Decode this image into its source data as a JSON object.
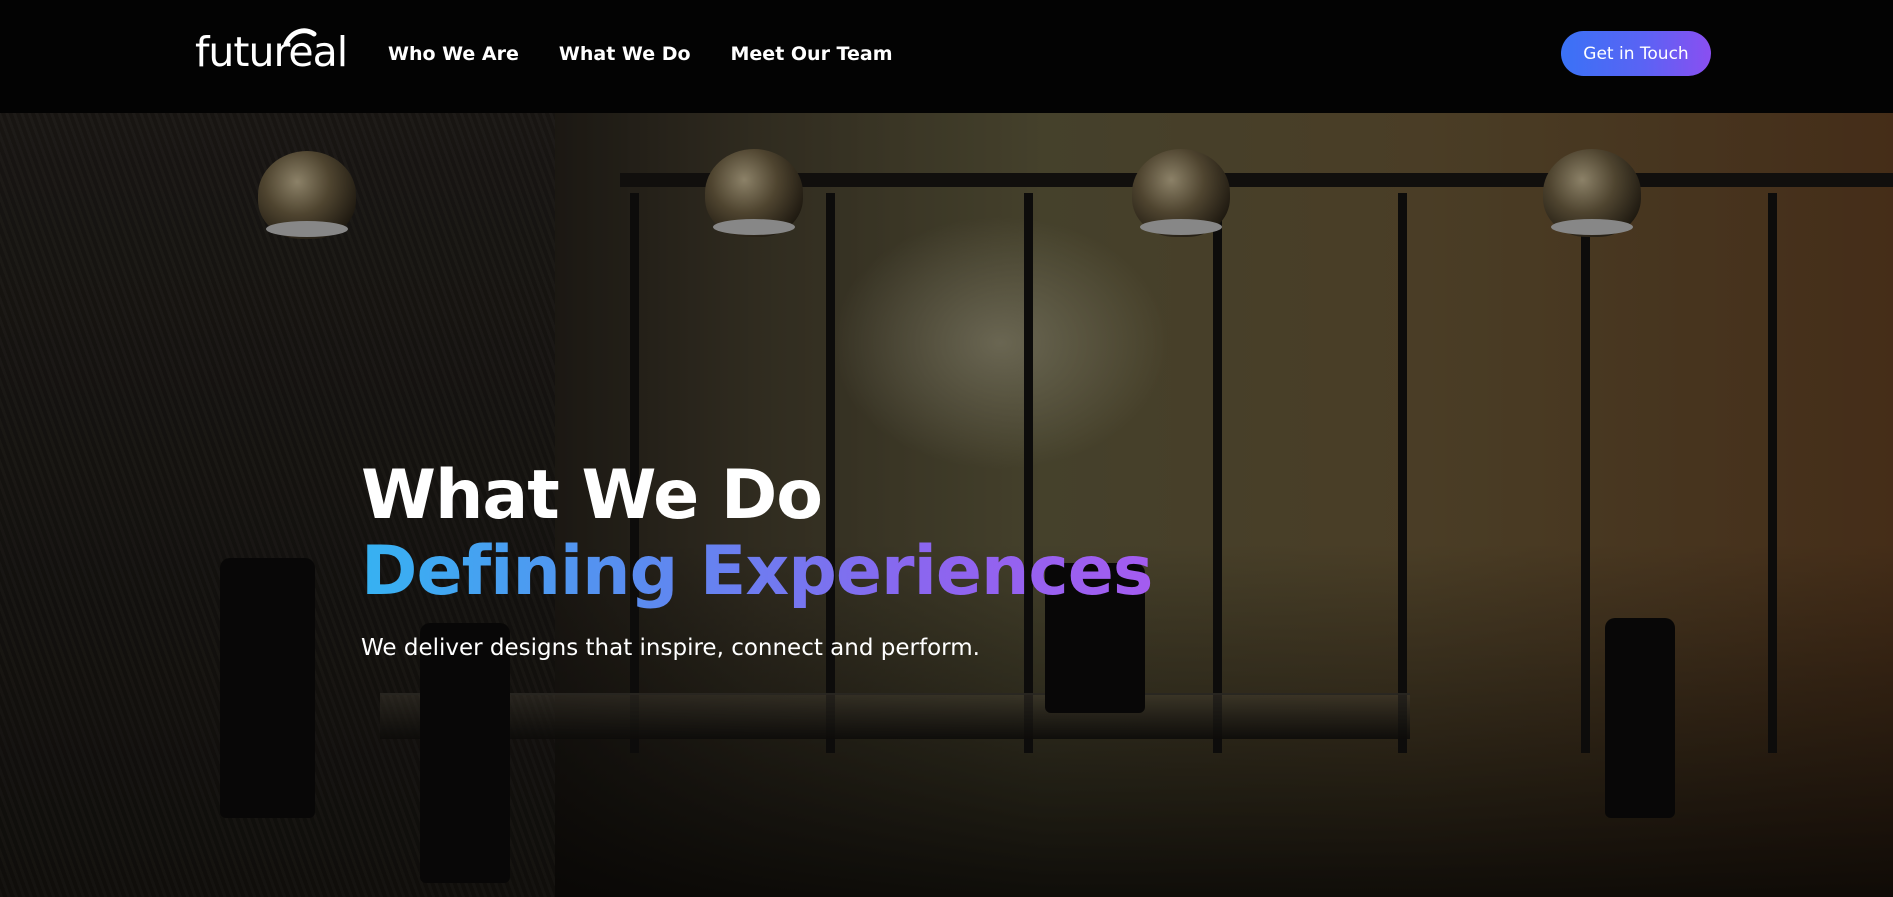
{
  "header": {
    "logo_text": "futureal",
    "nav": [
      {
        "label": "Who We Are"
      },
      {
        "label": "What We Do"
      },
      {
        "label": "Meet Our Team"
      }
    ],
    "cta_label": "Get in Touch"
  },
  "hero": {
    "title": "What We Do",
    "highlight": "Defining Experiences",
    "subtitle": "We deliver designs that inspire, connect and perform."
  },
  "colors": {
    "header_bg": "#030303",
    "cta_gradient_start": "#3a72f6",
    "cta_gradient_end": "#8a4ff1",
    "highlight_gradient_start": "#36b2f2",
    "highlight_gradient_end": "#a45cf0"
  }
}
